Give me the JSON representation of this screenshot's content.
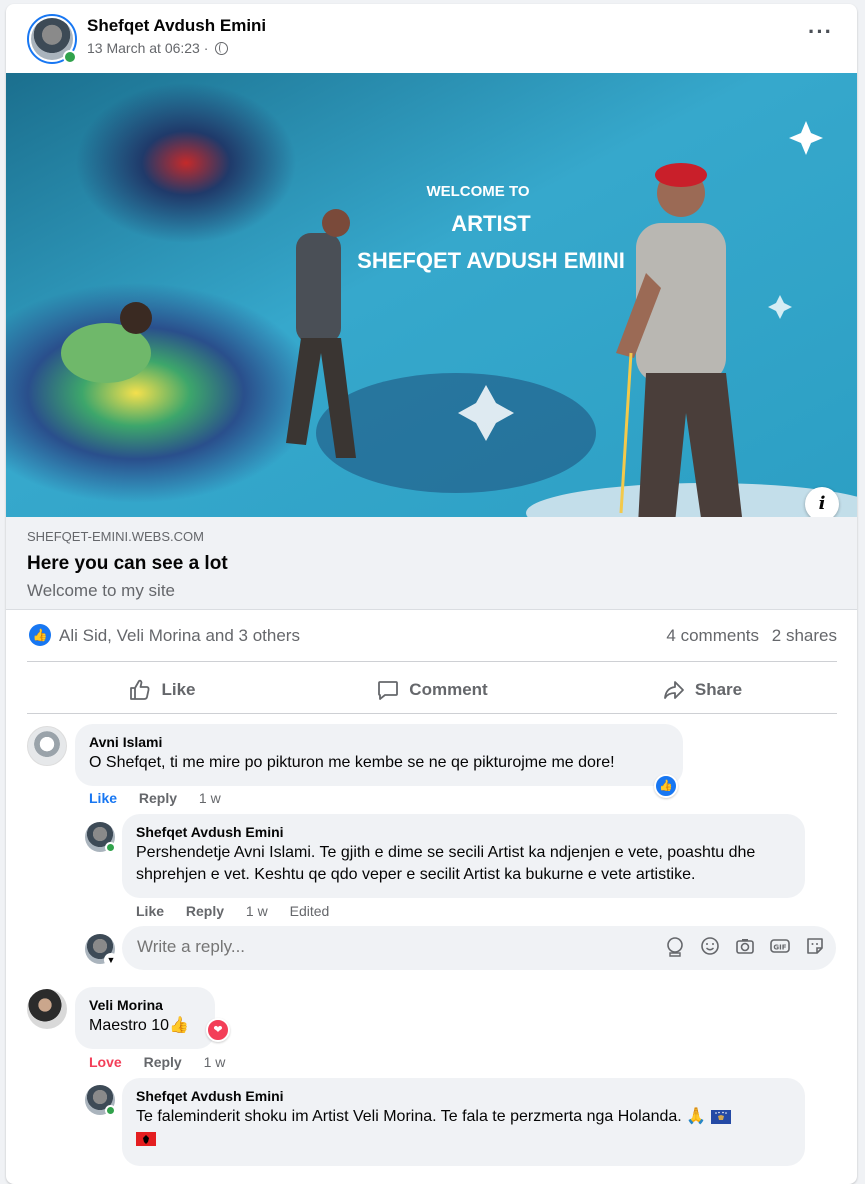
{
  "post": {
    "author": "Shefqet Avdush Emini",
    "timestamp": "13 March at 06:23",
    "privacy_separator": "·"
  },
  "link_preview": {
    "domain": "SHEFQET-EMINI.WEBS.COM",
    "title": "Here you can see a lot",
    "description": "Welcome to my site",
    "image_text": {
      "line1": "WELCOME TO",
      "line2": "ARTIST",
      "line3": "SHEFQET AVDUSH EMINI"
    }
  },
  "reactions": {
    "summary": "Ali Sid, Veli Morina and 3 others",
    "comments": "4 comments",
    "shares": "2 shares"
  },
  "actions": {
    "like": "Like",
    "comment": "Comment",
    "share": "Share"
  },
  "comments": [
    {
      "author": "Avni Islami",
      "text": "O Shefqet, ti me mire po pikturon me kembe se ne qe pikturojme me dore!",
      "action_like": "Like",
      "action_reply": "Reply",
      "time": "1 w"
    },
    {
      "author": "Shefqet Avdush Emini",
      "text": "Pershendetje Avni Islami. Te gjith e dime se secili Artist ka ndjenjen e vete, poashtu dhe shprehjen e vet. Keshtu qe qdo veper e secilit Artist ka bukurne e vete artistike.",
      "action_like": "Like",
      "action_reply": "Reply",
      "time": "1 w",
      "edited": "Edited"
    },
    {
      "author": "Veli Morina",
      "text": "Maestro 10",
      "action_like": "Love",
      "action_reply": "Reply",
      "time": "1 w"
    },
    {
      "author": "Shefqet Avdush Emini",
      "text": "Te faleminderit shoku im Artist Veli Morina. Te fala te perzmerta nga Holanda."
    }
  ],
  "reply_box": {
    "placeholder": "Write a reply..."
  },
  "colors": {
    "accent": "#1877f2",
    "love": "#f33e58",
    "online": "#31a24c"
  }
}
